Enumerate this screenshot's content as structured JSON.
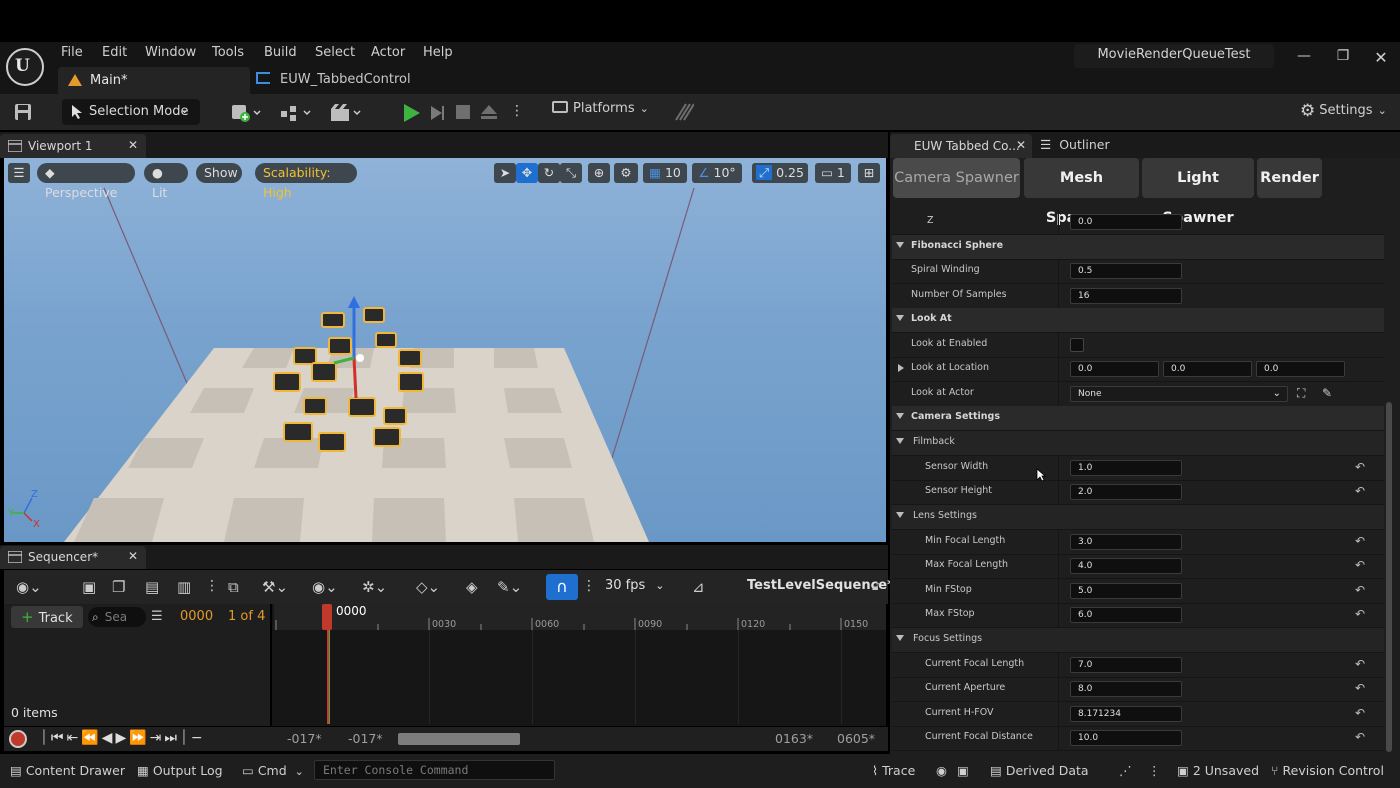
{
  "menu": [
    "File",
    "Edit",
    "Window",
    "Tools",
    "Build",
    "Select",
    "Actor",
    "Help"
  ],
  "project_name": "MovieRenderQueueTest",
  "tabs": {
    "main": "Main*",
    "euw": "EUW_TabbedControl"
  },
  "toolbar": {
    "selection_mode": "Selection Mode",
    "platforms": "Platforms",
    "settings": "Settings"
  },
  "viewport": {
    "tab": "Viewport 1",
    "perspective": "Perspective",
    "lit": "Lit",
    "show": "Show",
    "scalability": "Scalability: High",
    "grid_snap": "10",
    "angle_snap": "10°",
    "scale_snap": "0.25",
    "camera_speed": "1",
    "axis": {
      "z": "Z",
      "y": "Y",
      "x": "X"
    }
  },
  "sequencer": {
    "tab": "Sequencer*",
    "track_label": "Track",
    "search_placeholder": "Sea",
    "frame": "0000",
    "of_count": "1 of 4",
    "fps": "30 fps",
    "sequence_name": "TestLevelSequence*",
    "items": "0 items",
    "playhead": "0000",
    "ruler_ticks": [
      "0030",
      "0060",
      "0090",
      "0120",
      "0150"
    ],
    "range_start_a": "-017*",
    "range_start_b": "-017*",
    "range_end_a": "0163*",
    "range_end_b": "0605*"
  },
  "details": {
    "tab1": "EUW Tabbed Co...",
    "tab2": "Outliner",
    "subtabs": [
      "Camera Spawner",
      "Mesh Spawner",
      "Light Spawner",
      "Render"
    ],
    "rows": {
      "z": {
        "label": "Z",
        "value": "0.0"
      },
      "fib": "Fibonacci Sphere",
      "spiral": {
        "label": "Spiral Winding",
        "value": "0.5"
      },
      "samples": {
        "label": "Number Of Samples",
        "value": "16"
      },
      "lookat": "Look At",
      "lookat_enabled": "Look at Enabled",
      "lookat_loc": {
        "label": "Look at Location",
        "x": "0.0",
        "y": "0.0",
        "z": "0.0"
      },
      "lookat_actor": {
        "label": "Look at Actor",
        "value": "None"
      },
      "cam_settings": "Camera Settings",
      "filmback": "Filmback",
      "sensor_w": {
        "label": "Sensor Width",
        "value": "1.0"
      },
      "sensor_h": {
        "label": "Sensor Height",
        "value": "2.0"
      },
      "lens": "Lens Settings",
      "min_focal": {
        "label": "Min Focal Length",
        "value": "3.0"
      },
      "max_focal": {
        "label": "Max Focal Length",
        "value": "4.0"
      },
      "min_fstop": {
        "label": "Min FStop",
        "value": "5.0"
      },
      "max_fstop": {
        "label": "Max FStop",
        "value": "6.0"
      },
      "focus": "Focus Settings",
      "cur_focal": {
        "label": "Current Focal Length",
        "value": "7.0"
      },
      "cur_aperture": {
        "label": "Current Aperture",
        "value": "8.0"
      },
      "cur_hfov": {
        "label": "Current H-FOV",
        "value": "8.171234"
      },
      "cur_focus_dist": {
        "label": "Current Focal Distance",
        "value": "10.0"
      }
    }
  },
  "statusbar": {
    "content_drawer": "Content Drawer",
    "output_log": "Output Log",
    "cmd": "Cmd",
    "console_placeholder": "Enter Console Command",
    "trace": "Trace",
    "derived_data": "Derived Data",
    "unsaved": "2 Unsaved",
    "revision": "Revision Control"
  },
  "colors": {
    "accent_play": "#3fb33f",
    "scalability": "#f1c232",
    "frame_orange": "#e59a2a",
    "snap_blue": "#1e6fd0"
  }
}
